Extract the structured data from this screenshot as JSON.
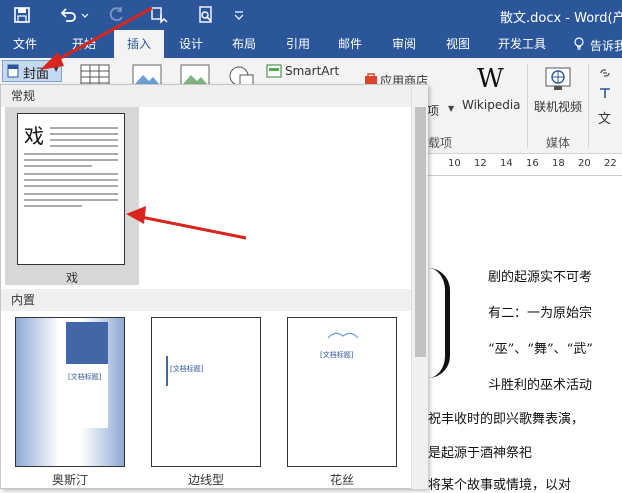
{
  "window": {
    "title": "散文.docx - Word(产品"
  },
  "quick_access": {
    "icons": [
      "save-icon",
      "undo-icon",
      "redo-icon",
      "touch-mode-icon",
      "print-preview-icon"
    ]
  },
  "tabs": [
    {
      "label": "文件"
    },
    {
      "label": "开始"
    },
    {
      "label": "插入"
    },
    {
      "label": "设计"
    },
    {
      "label": "布局"
    },
    {
      "label": "引用"
    },
    {
      "label": "邮件"
    },
    {
      "label": "审阅"
    },
    {
      "label": "视图"
    },
    {
      "label": "开发工具"
    }
  ],
  "tell_me": "告诉我",
  "ribbon": {
    "cover_button": "封面",
    "smartart": "SmartArt",
    "app_store": "应用商店",
    "wikipedia_glyph": "W",
    "wikipedia": "Wikipedia",
    "online_video": "联机视频",
    "addins_fragment": "项",
    "addins_group_fragment": "载项",
    "media_group": "媒体",
    "right_fragment": "文"
  },
  "ruler": {
    "numbers": [
      "10",
      "12",
      "14",
      "16",
      "18",
      "20",
      "22"
    ]
  },
  "document": {
    "lines": [
      "剧的起源实不可考",
      "有二：一为原始宗",
      "“巫”、“舞”、“武”",
      "斗胜利的巫术活动",
      "祝丰收时的即兴歌舞表演，",
      "是起源于酒神祭祀",
      "将某个故事或情境，以对"
    ]
  },
  "dropdown": {
    "sections": {
      "regular": "常规",
      "builtin": "内置"
    },
    "regular_item": {
      "caption": "戏",
      "heading_glyph": "戏"
    },
    "builtin_items": [
      {
        "caption": "奥斯汀",
        "title_placeholder": "[文档标题]"
      },
      {
        "caption": "边线型",
        "title_placeholder": "[文档标题]"
      },
      {
        "caption": "花丝",
        "title_placeholder": "[文档标题]"
      }
    ]
  },
  "colors": {
    "brand": "#2b579a",
    "annotation_arrow": "#d9261c"
  }
}
